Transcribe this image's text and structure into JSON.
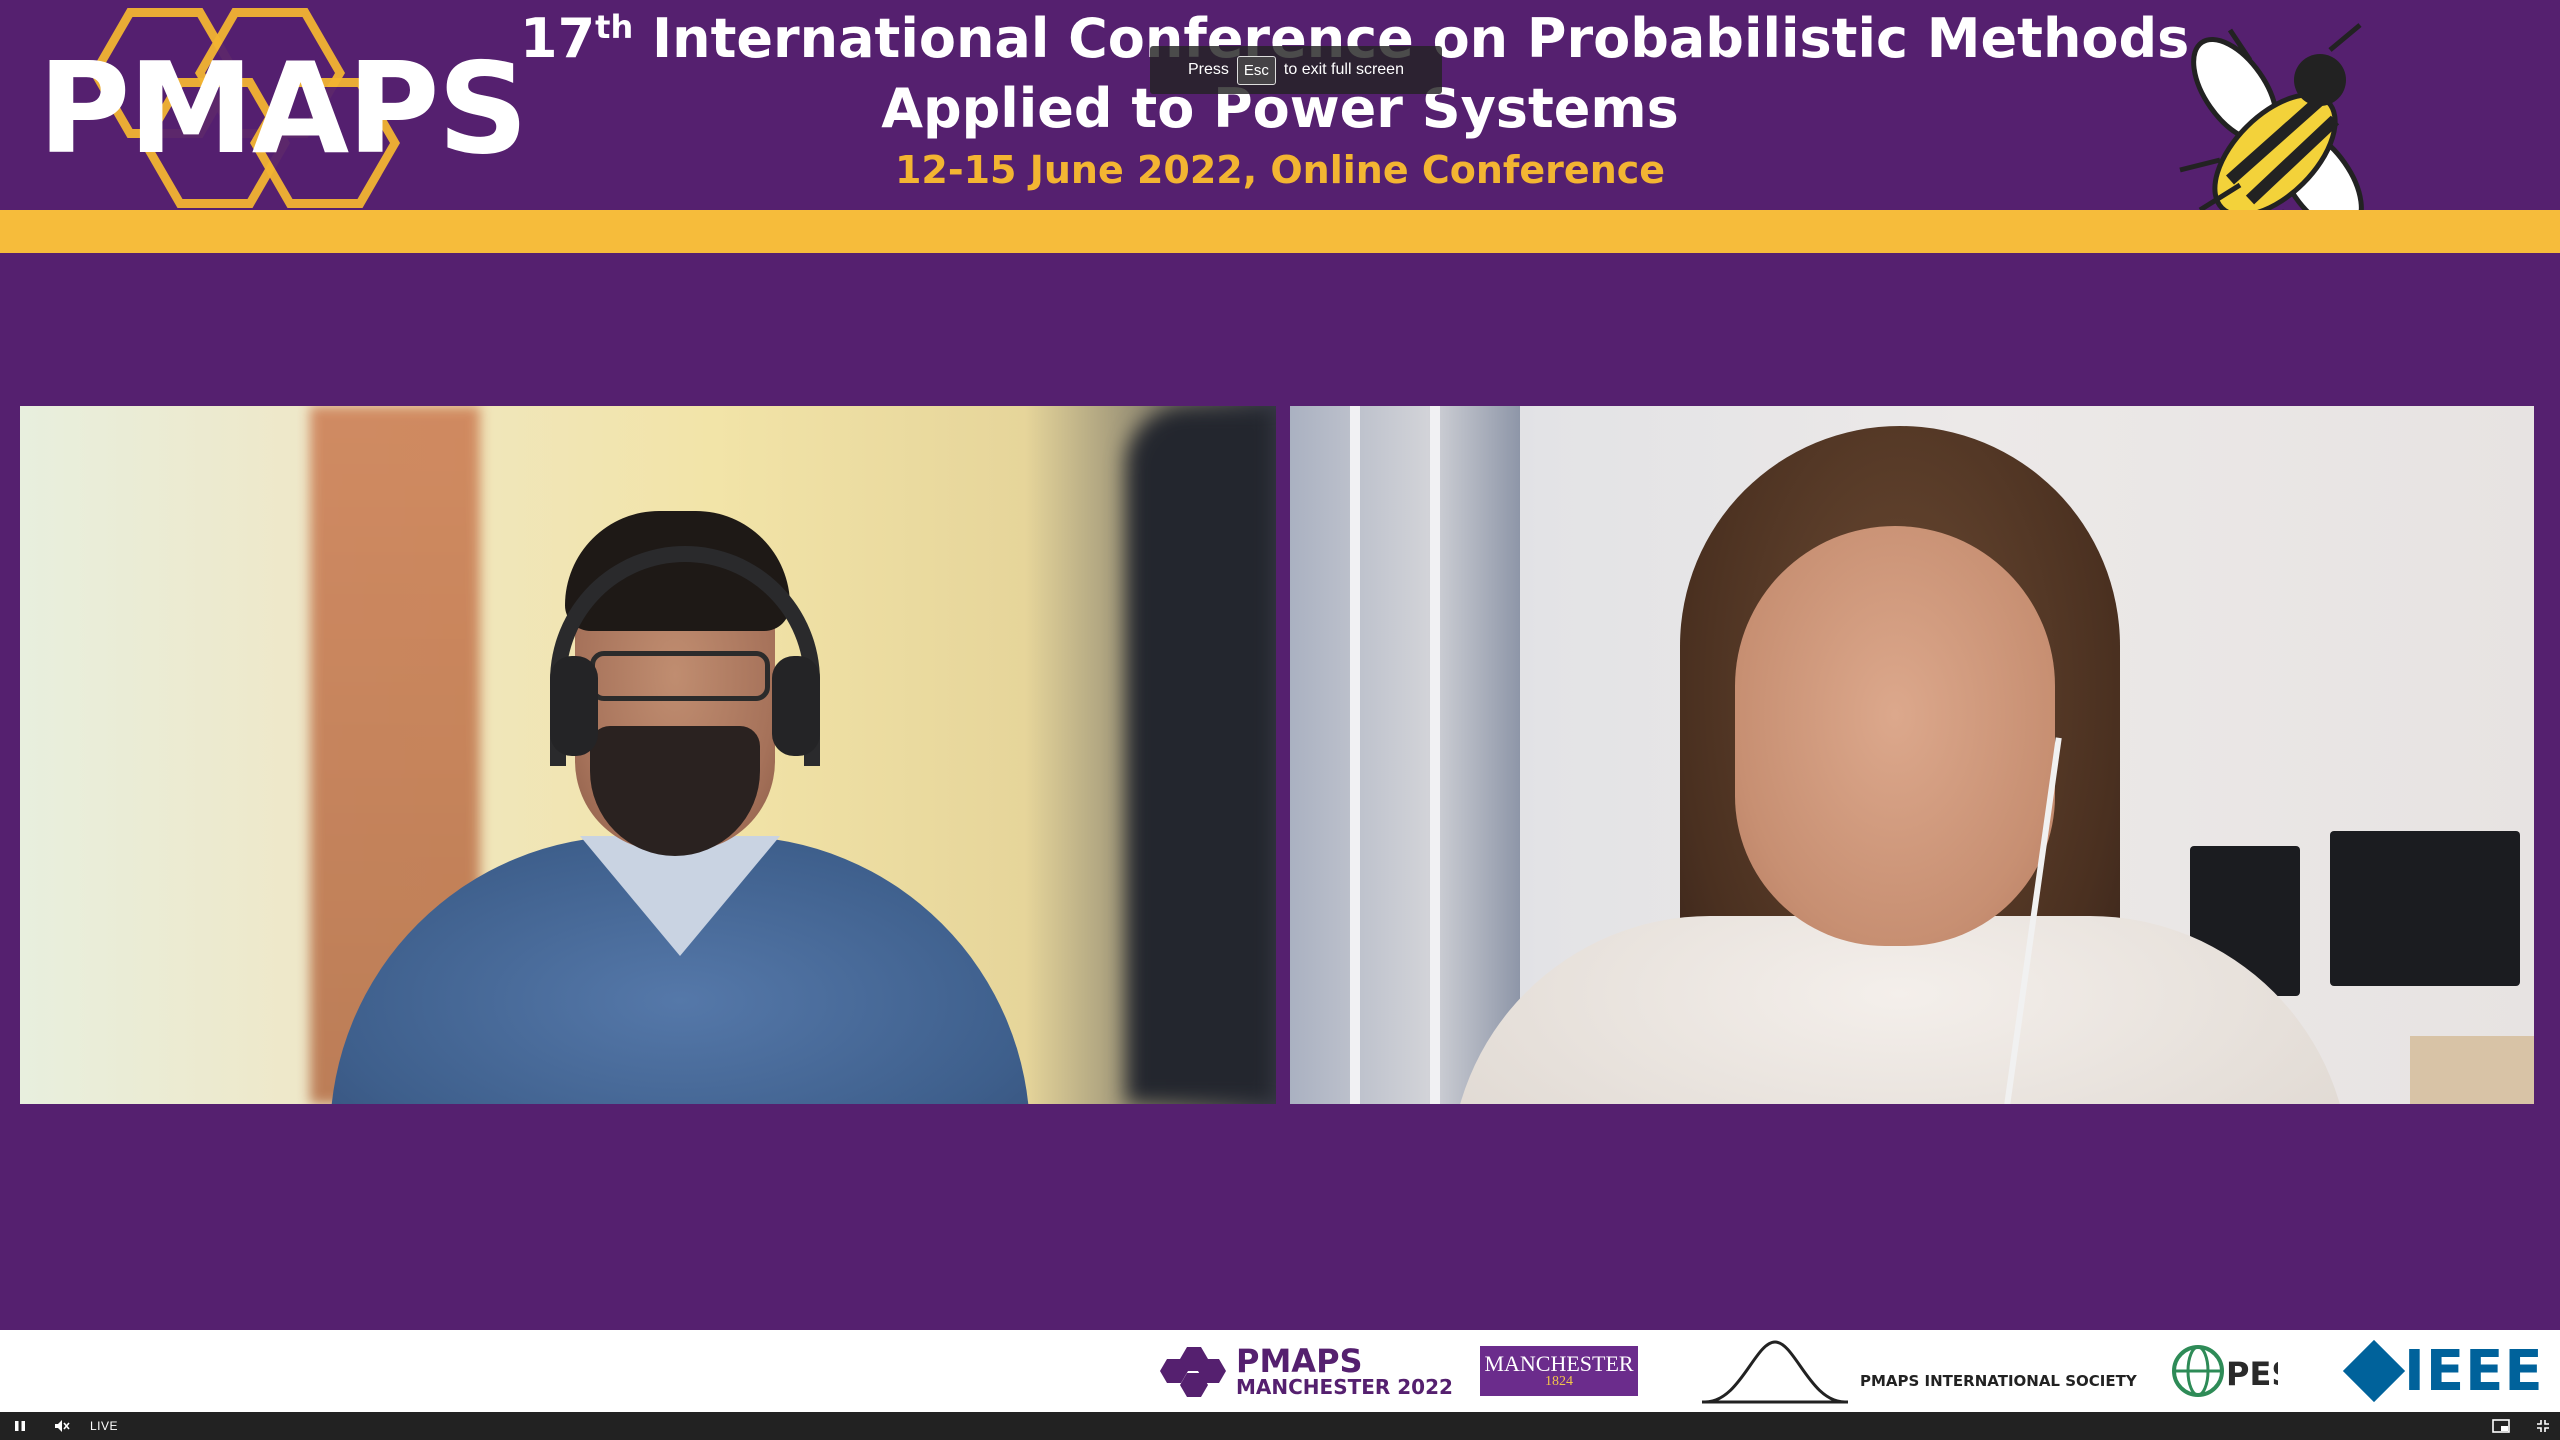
{
  "banner": {
    "logo_text": "PMAPS",
    "title_ordinal_num": "17",
    "title_ordinal_sup": "th",
    "title_line1_rest": "International Conference on Probabilistic Methods",
    "title_line2": "Applied to Power Systems",
    "subtitle": "12-15 June 2022, Online Conference",
    "colors": {
      "purple": "#55206f",
      "gold": "#f6bc3b",
      "white": "#ffffff"
    }
  },
  "fullscreen_hint": {
    "prefix": "Press",
    "key": "Esc",
    "suffix": "to exit full screen"
  },
  "video_tiles": [
    {
      "id": "participant-1"
    },
    {
      "id": "participant-2"
    }
  ],
  "sponsors": {
    "pmaps_name": "PMAPS",
    "pmaps_sub": "MANCHESTER 2022",
    "manchester_name": "MANCHESTER",
    "manchester_year": "1824",
    "society": "PMAPS INTERNATIONAL SOCIETY",
    "pes": "PES",
    "ieee": "IEEE"
  },
  "player": {
    "live_label": "LIVE",
    "icons": [
      "pause-icon",
      "muted-speaker-icon",
      "picture-in-picture-icon",
      "exit-fullscreen-icon"
    ]
  }
}
